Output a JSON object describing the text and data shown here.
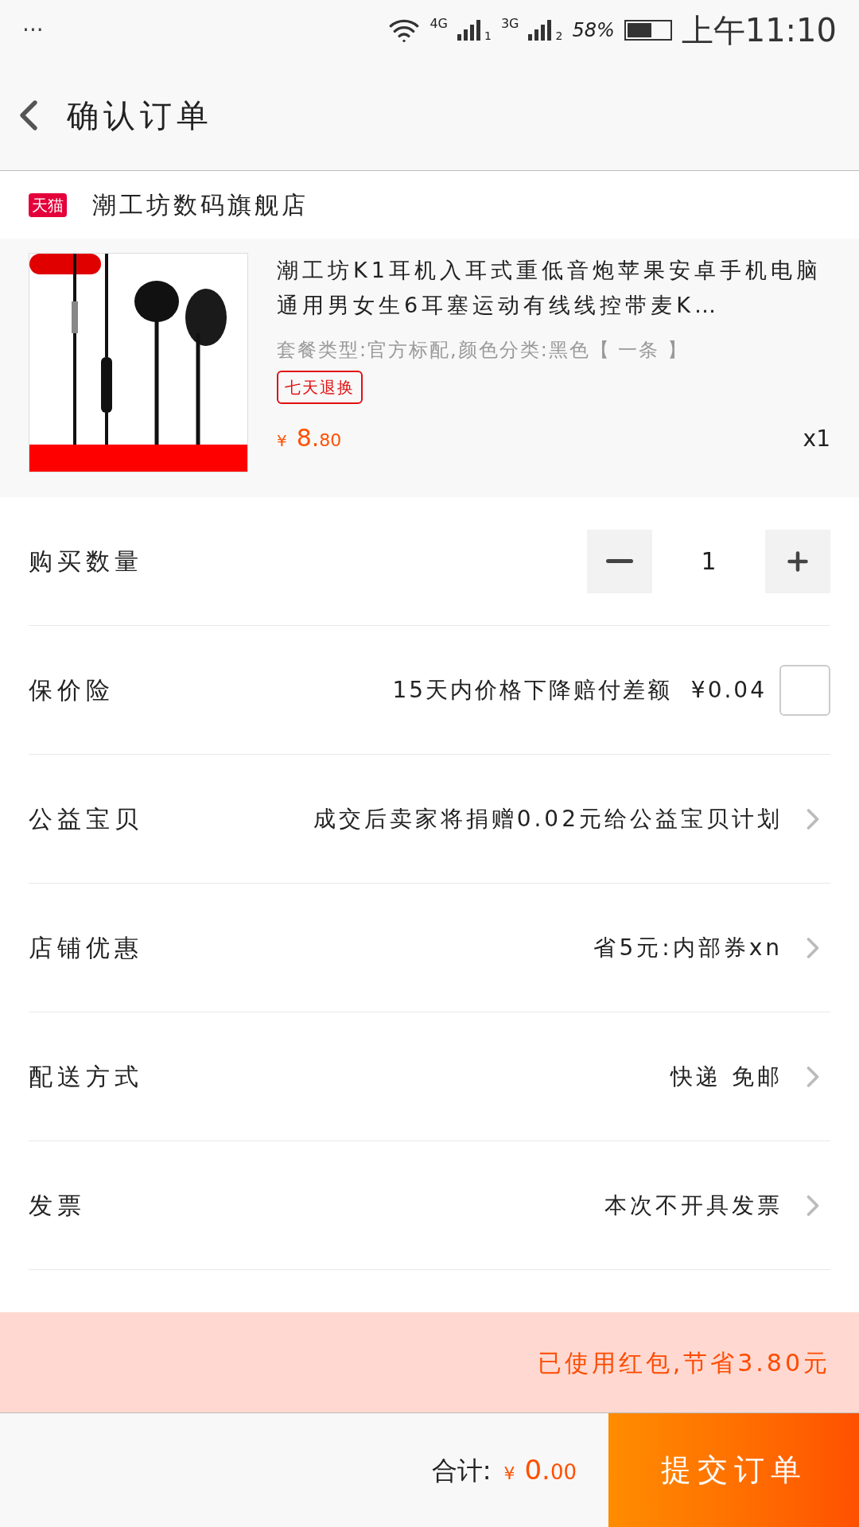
{
  "status_bar": {
    "menu": "···",
    "net1": "4G",
    "sim1": "1",
    "net2": "3G",
    "sim2": "2",
    "battery": "58%",
    "time": "上午11:10"
  },
  "header": {
    "title": "确认订单"
  },
  "store": {
    "badge": "天猫",
    "name": "潮工坊数码旗舰店"
  },
  "product": {
    "title": "潮工坊K1耳机入耳式重低音炮苹果安卓手机电脑通用男女生6耳塞运动有线线控带麦K…",
    "spec": "套餐类型:官方标配,颜色分类:黑色【 一条 】",
    "tag": "七天退换",
    "price_symbol": "¥",
    "price_int": "8.",
    "price_dec": "80",
    "qty": "x1"
  },
  "rows": [
    {
      "kind": "stepper",
      "label": "购买数量",
      "value": "1"
    },
    {
      "kind": "checkbox",
      "label": "保价险",
      "value": "15天内价格下降赔付差额  ¥0.04",
      "checked": false
    },
    {
      "kind": "link",
      "label": "公益宝贝",
      "value": "成交后卖家将捐赠0.02元给公益宝贝计划"
    },
    {
      "kind": "link",
      "label": "店铺优惠",
      "value": "省5元:内部券xn"
    },
    {
      "kind": "link",
      "label": "配送方式",
      "value": "快递 免邮"
    },
    {
      "kind": "link",
      "label": "发票",
      "value": "本次不开具发票"
    }
  ],
  "banner": "已使用红包,节省3.80元",
  "footer": {
    "total_label": "合计:",
    "symbol": "¥",
    "amount_int": "0.",
    "amount_dec": "00",
    "submit": "提交订单"
  }
}
